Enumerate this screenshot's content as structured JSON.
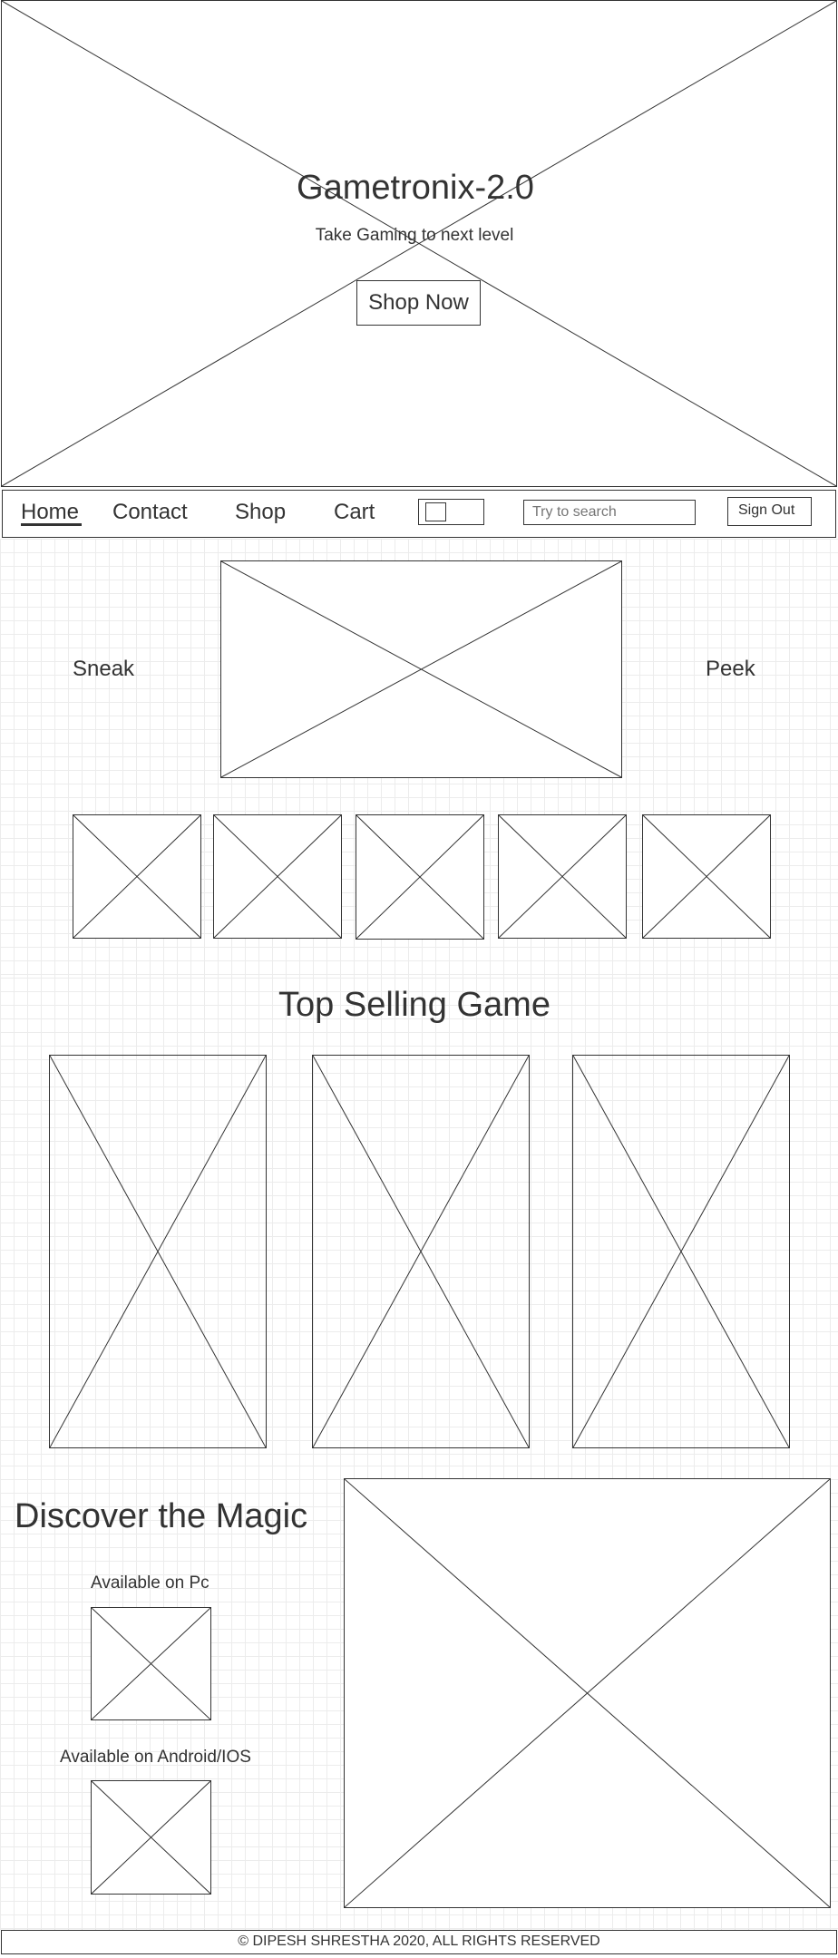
{
  "hero": {
    "title": "Gametronix-2.0",
    "subtitle": "Take Gaming to next level",
    "cta_label": "Shop Now"
  },
  "nav": {
    "items": [
      {
        "label": "Home",
        "active": true
      },
      {
        "label": "Contact"
      },
      {
        "label": "Shop"
      },
      {
        "label": "Cart"
      }
    ],
    "search_placeholder": "Try to search",
    "signout_label": "Sign Out"
  },
  "carousel": {
    "left_label": "Sneak",
    "right_label": "Peek"
  },
  "top_selling": {
    "title": "Top Selling Game"
  },
  "discover": {
    "title": "Discover the Magic",
    "pc_label": "Available on Pc",
    "mobile_label": "Available on Android/IOS"
  },
  "footer": {
    "text": "© DIPESH SHRESTHA 2020, ALL RIGHTS RESERVED"
  }
}
